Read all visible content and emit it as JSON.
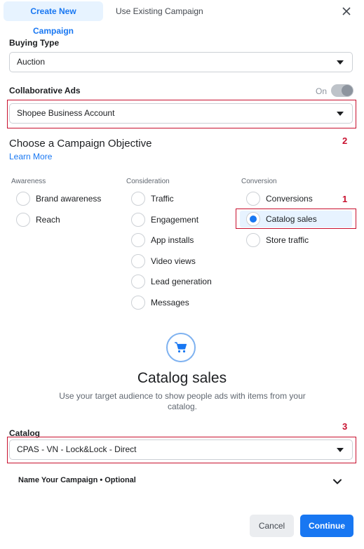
{
  "tabs": {
    "active": "Create New Campaign",
    "inactive": "Use Existing Campaign"
  },
  "buying_type": {
    "label": "Buying Type",
    "value": "Auction"
  },
  "collaborative_ads": {
    "label": "Collaborative Ads",
    "toggle_label": "On",
    "toggle_on": true,
    "value": "Shopee Business Account"
  },
  "objective": {
    "heading": "Choose a Campaign Objective",
    "learn_more": "Learn More",
    "columns": [
      {
        "title": "Awareness",
        "options": [
          {
            "label": "Brand awareness",
            "checked": false
          },
          {
            "label": "Reach",
            "checked": false
          }
        ]
      },
      {
        "title": "Consideration",
        "options": [
          {
            "label": "Traffic",
            "checked": false
          },
          {
            "label": "Engagement",
            "checked": false
          },
          {
            "label": "App installs",
            "checked": false
          },
          {
            "label": "Video views",
            "checked": false
          },
          {
            "label": "Lead generation",
            "checked": false
          },
          {
            "label": "Messages",
            "checked": false
          }
        ]
      },
      {
        "title": "Conversion",
        "options": [
          {
            "label": "Conversions",
            "checked": false
          },
          {
            "label": "Catalog sales",
            "checked": true
          },
          {
            "label": "Store traffic",
            "checked": false
          }
        ]
      }
    ]
  },
  "selected_objective": {
    "icon": "shopping-cart-icon",
    "title": "Catalog sales",
    "description": "Use your target audience to show people ads with items from your catalog."
  },
  "catalog": {
    "label": "Catalog",
    "value": "CPAS - VN - Lock&Lock - Direct"
  },
  "name_campaign": {
    "label": "Name Your Campaign • Optional"
  },
  "annotations": {
    "one": "1",
    "two": "2",
    "three": "3"
  },
  "footer": {
    "cancel": "Cancel",
    "continue": "Continue"
  },
  "colors": {
    "accent": "#1877f2",
    "accent_light": "#e7f3ff",
    "annotation_red": "#c8102e"
  }
}
